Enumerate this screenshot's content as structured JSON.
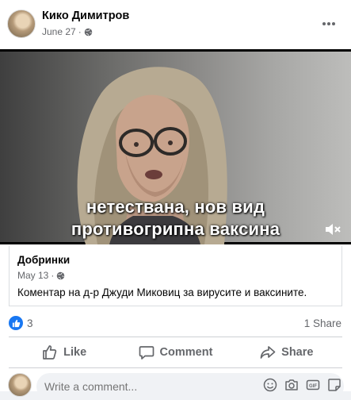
{
  "post": {
    "author": "Кико Димитров",
    "date": "June 27",
    "dot": "·",
    "more_icon": "more-horizontal-icon",
    "privacy_icon": "globe-icon"
  },
  "video": {
    "subtitle_line1": "нетествана, нов вид",
    "subtitle_line2": "противогрипна ваксина",
    "mute_icon": "speaker-muted-icon"
  },
  "shared": {
    "page_name": "Добринки",
    "date": "May 13",
    "dot": "·",
    "text": "Коментар на д-р Джуди Миковиц за вирусите и ваксините."
  },
  "stats": {
    "reaction_icon": "like-reaction-icon",
    "reaction_count": "3",
    "shares": "1 Share"
  },
  "actions": {
    "like": "Like",
    "comment": "Comment",
    "share": "Share"
  },
  "composer": {
    "placeholder": "Write a comment..."
  },
  "colors": {
    "accent": "#1877f2",
    "secondary_text": "#65676b",
    "divider": "#ced0d4"
  }
}
